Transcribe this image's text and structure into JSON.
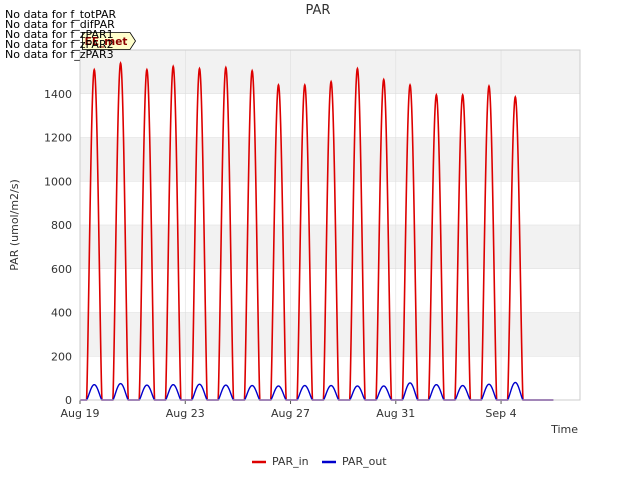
{
  "no_data_messages": [
    "No data for f_totPAR",
    "No data for f_difPAR",
    "No data for f_zPAR1",
    "No data for f_zPAR2",
    "No data for f_zPAR3"
  ],
  "tooltip_label": "EE_met",
  "colors": {
    "PAR_in": "#dd0000",
    "PAR_out": "#0000cc",
    "band": "#f2f2f2",
    "grid": "#dddddd"
  },
  "chart_data": {
    "type": "line",
    "title": "PAR",
    "xlabel": "Time",
    "ylabel": "PAR (umol/m2/s)",
    "xlim": [
      "2023-08-19",
      "2023-09-07"
    ],
    "ylim": [
      0,
      1600
    ],
    "yticks": [
      0,
      200,
      400,
      600,
      800,
      1000,
      1200,
      1400
    ],
    "xticks": [
      {
        "date": "2023-08-19",
        "label": "Aug 19"
      },
      {
        "date": "2023-08-23",
        "label": "Aug 23"
      },
      {
        "date": "2023-08-27",
        "label": "Aug 27"
      },
      {
        "date": "2023-08-31",
        "label": "Aug 31"
      },
      {
        "date": "2023-09-04",
        "label": "Sep 4"
      }
    ],
    "grid": true,
    "legend_position": "bottom",
    "series": [
      {
        "name": "PAR_in",
        "days": [
          "2023-08-19",
          "2023-08-20",
          "2023-08-21",
          "2023-08-22",
          "2023-08-23",
          "2023-08-24",
          "2023-08-25",
          "2023-08-26",
          "2023-08-27",
          "2023-08-28",
          "2023-08-29",
          "2023-08-30",
          "2023-08-31",
          "2023-09-01",
          "2023-09-02",
          "2023-09-03",
          "2023-09-04",
          "2023-09-05"
        ],
        "daily_peak": [
          1510,
          1540,
          1510,
          1525,
          1515,
          1520,
          1505,
          1440,
          1440,
          1455,
          1515,
          1465,
          1440,
          1395,
          1395,
          1435,
          1385,
          0
        ]
      },
      {
        "name": "PAR_out",
        "days": [
          "2023-08-19",
          "2023-08-20",
          "2023-08-21",
          "2023-08-22",
          "2023-08-23",
          "2023-08-24",
          "2023-08-25",
          "2023-08-26",
          "2023-08-27",
          "2023-08-28",
          "2023-08-29",
          "2023-08-30",
          "2023-08-31",
          "2023-09-01",
          "2023-09-02",
          "2023-09-03",
          "2023-09-04",
          "2023-09-05"
        ],
        "daily_peak": [
          70,
          75,
          68,
          70,
          72,
          68,
          66,
          64,
          66,
          66,
          64,
          64,
          78,
          70,
          66,
          72,
          80,
          0
        ]
      }
    ]
  }
}
